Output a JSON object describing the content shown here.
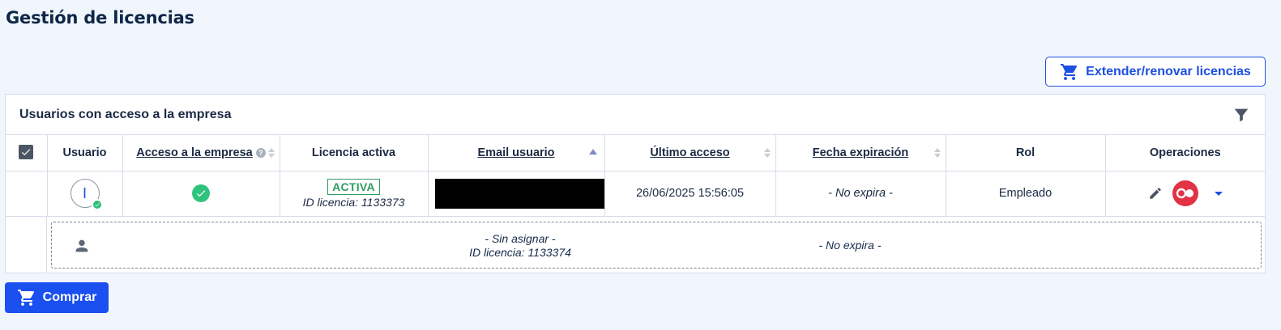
{
  "page": {
    "title": "Gestión de licencias"
  },
  "toolbar": {
    "extend_label": "Extender/renovar licencias",
    "buy_label": "Comprar"
  },
  "panel": {
    "title": "Usuarios con acceso a la empresa"
  },
  "table": {
    "columns": [
      {
        "key": "select",
        "label": ""
      },
      {
        "key": "user",
        "label": "Usuario"
      },
      {
        "key": "company_access",
        "label": "Acceso a la empresa"
      },
      {
        "key": "active_license",
        "label": "Licencia activa"
      },
      {
        "key": "email",
        "label": "Email usuario"
      },
      {
        "key": "last_access",
        "label": "Último acceso"
      },
      {
        "key": "expiry",
        "label": "Fecha expiración"
      },
      {
        "key": "role",
        "label": "Rol"
      },
      {
        "key": "operations",
        "label": "Operaciones"
      }
    ],
    "rows": [
      {
        "avatar_initial": "I",
        "license_status": "ACTIVA",
        "license_id": "ID licencia: 1133373",
        "last_access": "26/06/2025 15:56:05",
        "expiry": "- No expira -",
        "role": "Empleado"
      }
    ],
    "unassigned": {
      "status": "- Sin asignar -",
      "license_id": "ID licencia: 1133374",
      "expiry": "- No expira -"
    }
  },
  "colors": {
    "primary": "#1d4fe0",
    "success": "#2fc37c",
    "danger": "#e13246",
    "background": "#f1f6fd"
  },
  "icons": [
    "cart-icon",
    "filter-icon",
    "help-icon",
    "check-circle-icon",
    "edit-icon",
    "record-icon",
    "chevron-down-icon",
    "user-icon"
  ]
}
